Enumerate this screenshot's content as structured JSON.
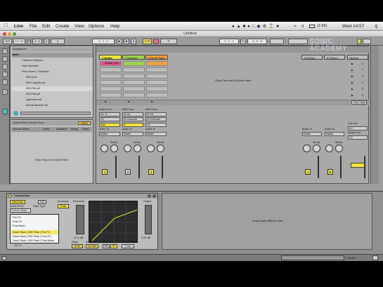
{
  "menubar": {
    "app_name": "Live",
    "items": [
      "File",
      "Edit",
      "Create",
      "View",
      "Options",
      "Help"
    ],
    "battery": "(1:56)",
    "clock": "Wed 14:57"
  },
  "window": {
    "title": "Untitled"
  },
  "toolbar": {
    "tap": "TAP",
    "tempo": "127.00",
    "meter": "4 / 4",
    "position": "1 . 1 . 1",
    "ovr": "OVR",
    "loop_start": "1 . 1 . 1",
    "loop_length": "4 . 0 . 0"
  },
  "browser": {
    "path": "/Samples/ ▾",
    "header": "Name",
    "items": [
      "Crashes Samples",
      "Hats Samples",
      "Kick Drums 1 Samples",
      "909 Q.aif",
      "909 Long Bd.aif",
      "909 Pfeil.aif",
      "909 Pilot.aif",
      "Agression.aif",
      "Almost Bounce.aif"
    ]
  },
  "groove_pool": {
    "title": "Current Set's Groove Pool",
    "percent": "100%",
    "columns": [
      "Groove Name",
      "Base",
      "Quantize",
      "Timing",
      "Rand"
    ],
    "placeholder": "Drop Clips or Grooves Here"
  },
  "tracks": [
    {
      "name": "1 Audio",
      "color": "#f0e43a",
      "clip": "Analog_Gen",
      "number": "1",
      "input": "Ext. In",
      "channel": "1/2",
      "monitor": "Auto"
    },
    {
      "name": "2 Impulse",
      "color": "#9fd24d",
      "number": "2",
      "input": "All Ins",
      "channel": "All Channels",
      "monitor": "In"
    },
    {
      "name": "3 Drum Rack",
      "color": "#f0a040",
      "number": "3",
      "input": "All Ins",
      "channel": "All Channels",
      "monitor": "Off"
    }
  ],
  "returns": [
    {
      "name": "A Return",
      "letter": "A"
    },
    {
      "name": "B Return",
      "letter": "B"
    }
  ],
  "master": {
    "name": "Master",
    "scenes": [
      "1",
      "2",
      "3",
      "4",
      "5",
      "6",
      "7"
    ],
    "stop_clips": "Stop Clips",
    "cue_out": "Cue Out",
    "cue_value": "1/2",
    "master_out": "Master Out"
  },
  "session": {
    "drop_hint": "Drop Files and Devices Here",
    "labels": {
      "audio_from": "Audio From",
      "midi_from": "MIDI From",
      "audio_to": "Audio To",
      "monitor_in": "In",
      "monitor_auto": "Auto",
      "monitor_off": "Off",
      "sends": "Sends",
      "master": "Master"
    }
  },
  "compressor": {
    "title": "Compressor",
    "sidechain_label": "Sidechain",
    "eq_label": "EQ",
    "audio_from_label": "Audio From",
    "audio_from_value": "3-Drum Rack",
    "filter_type_label": "Filter Type",
    "envelope_label": "Envelope",
    "peak_label": "Peak",
    "threshold_label": "Threshold",
    "output_label": "Output",
    "attack_value": "-10.4 dB",
    "output_value": "0.00 dB",
    "ratio_label": "Ratio",
    "knee_label": "Knee",
    "model_label": "Model",
    "lookahead_label": "Lookahead",
    "ratio_value": "4.00",
    "knee_value": "6.0 dB",
    "mode_fb": "FB",
    "mode_ff": "FF",
    "lookahead_value": "1 ms",
    "percent": "100 %"
  },
  "dropdown": {
    "items": [
      "Pre FX",
      "Post FX",
      "Post Mixer",
      "Drum Rack | 909 Peak | Pre FX",
      "Drum Rack | 909 Peak | Post FX",
      "Drum Rack | 909 Peak | Post Mixer"
    ],
    "selected_index": 3
  },
  "detail": {
    "effects_hint": "Drop Audio Effects Here"
  },
  "statusbar": {
    "track_label": "1-Audio"
  },
  "watermark": {
    "line1": "SONIC",
    "line2": "ACADEMY"
  }
}
